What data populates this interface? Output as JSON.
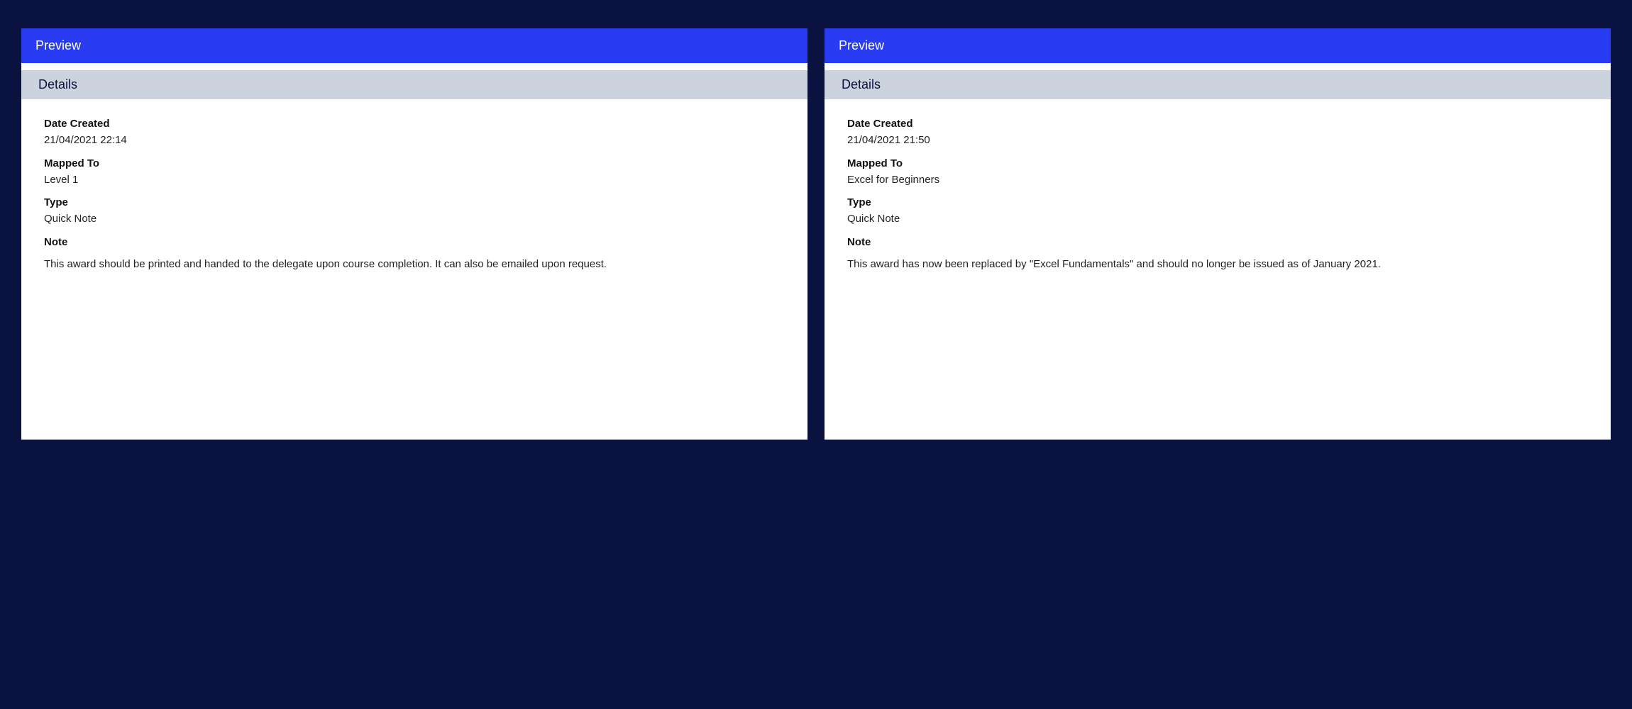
{
  "cards": [
    {
      "header": "Preview",
      "section_title": "Details",
      "fields": {
        "date_created_label": "Date Created",
        "date_created_value": "21/04/2021 22:14",
        "mapped_to_label": "Mapped To",
        "mapped_to_value": "Level 1",
        "type_label": "Type",
        "type_value": "Quick Note",
        "note_label": "Note",
        "note_value": "This award should be printed and handed to the delegate upon course completion. It can also be emailed upon request."
      }
    },
    {
      "header": "Preview",
      "section_title": "Details",
      "fields": {
        "date_created_label": "Date Created",
        "date_created_value": "21/04/2021 21:50",
        "mapped_to_label": "Mapped To",
        "mapped_to_value": "Excel for Beginners",
        "type_label": "Type",
        "type_value": "Quick Note",
        "note_label": "Note",
        "note_value": "This award has now been replaced by \"Excel Fundamentals\" and should no longer be issued as of January 2021."
      }
    }
  ]
}
